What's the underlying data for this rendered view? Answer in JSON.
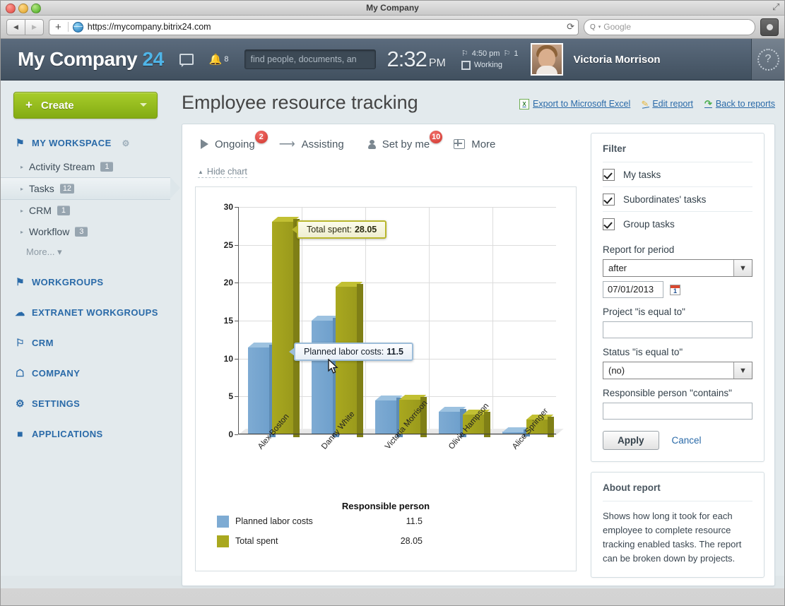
{
  "browser": {
    "window_title": "My Company",
    "url": "https://mycompany.bitrix24.com",
    "search_placeholder": "Google",
    "back_icon": "◀",
    "forward_icon": "▶",
    "plus_icon": "+",
    "reload_icon": "⟳",
    "magnifier_icon": "Q",
    "caret_icon": "▾",
    "resize_icon": "⤢"
  },
  "topbar": {
    "logo_text": "My Company",
    "logo_number": "24",
    "messages_count": "",
    "notifications_count": "8",
    "search_placeholder": "find people, documents, an",
    "clock_time": "2:32",
    "clock_ampm": "PM",
    "status_time": "4:50 pm",
    "status_flag_count": "1",
    "status_label": "Working",
    "user_name": "Victoria Morrison",
    "help_icon": "?"
  },
  "sidebar": {
    "create_label": "Create",
    "sections": [
      {
        "label": "MY WORKSPACE",
        "icon": "bookmark-icon",
        "glyph": "⚑",
        "gear": true
      },
      {
        "label": "WORKGROUPS",
        "icon": "group-icon",
        "glyph": "⚑"
      },
      {
        "label": "EXTRANET WORKGROUPS",
        "icon": "cloud-icon",
        "glyph": "☁"
      },
      {
        "label": "CRM",
        "icon": "flag-icon",
        "glyph": "⚑"
      },
      {
        "label": "COMPANY",
        "icon": "home-icon",
        "glyph": "⌂"
      },
      {
        "label": "SETTINGS",
        "icon": "gear-icon",
        "glyph": "⚙"
      },
      {
        "label": "APPLICATIONS",
        "icon": "cube-icon",
        "glyph": "⬛"
      }
    ],
    "workspace_items": [
      {
        "label": "Activity Stream",
        "badge": "1",
        "active": false
      },
      {
        "label": "Tasks",
        "badge": "12",
        "active": true
      },
      {
        "label": "CRM",
        "badge": "1",
        "active": false
      },
      {
        "label": "Workflow",
        "badge": "3",
        "active": false
      }
    ],
    "more_label": "More..."
  },
  "page": {
    "title": "Employee resource tracking",
    "links": [
      {
        "label": "Export to Microsoft Excel",
        "icon": "excel-icon"
      },
      {
        "label": "Edit report",
        "icon": "pencil-icon"
      },
      {
        "label": "Back to reports",
        "icon": "back-arrow-icon"
      }
    ]
  },
  "tabs": [
    {
      "label": "Ongoing",
      "badge": "2",
      "icon": "play-icon"
    },
    {
      "label": "Assisting",
      "badge": "",
      "icon": "arrow-icon"
    },
    {
      "label": "Set by me",
      "badge": "10",
      "icon": "person-icon"
    },
    {
      "label": "More",
      "badge": "",
      "icon": "grid-icon"
    }
  ],
  "hide_chart_label": "Hide chart",
  "chart_data": {
    "type": "bar",
    "title": "",
    "xlabel": "Responsible person",
    "ylabel": "",
    "categories": [
      "Alex Boston",
      "Danny White",
      "Victoria Morrison",
      "Olivia Hampson",
      "Alice Springer"
    ],
    "series": [
      {
        "name": "Planned labor costs",
        "color": "#7eabd3",
        "values": [
          11.5,
          15.0,
          4.5,
          3.0,
          0.35
        ]
      },
      {
        "name": "Total spent",
        "color": "#a9a81f",
        "values": [
          28.05,
          19.5,
          4.6,
          2.6,
          2.0
        ]
      }
    ],
    "ylim": [
      0,
      30
    ],
    "yticks": [
      0,
      5,
      10,
      15,
      20,
      25,
      30
    ],
    "grid": true,
    "legend_position": "bottom",
    "legend": [
      {
        "name": "Planned labor costs",
        "value": "11.5",
        "color": "#7eabd3"
      },
      {
        "name": "Total spent",
        "value": "28.05",
        "color": "#a9a81f"
      }
    ],
    "tooltips": [
      {
        "label": "Total spent:",
        "value": "28.05",
        "style": "olive"
      },
      {
        "label": "Planned labor costs:",
        "value": "11.5",
        "style": "blue"
      }
    ]
  },
  "filter": {
    "title": "Filter",
    "checkboxes": [
      {
        "label": "My tasks",
        "checked": true
      },
      {
        "label": "Subordinates' tasks",
        "checked": true
      },
      {
        "label": "Group tasks",
        "checked": true
      }
    ],
    "period_label": "Report for period",
    "period_value": "after",
    "date_value": "07/01/2013",
    "project_label": "Project \"is equal to\"",
    "project_value": "",
    "status_label": "Status \"is equal to\"",
    "status_value": "(no)",
    "responsible_label": "Responsible person \"contains\"",
    "responsible_value": "",
    "apply_label": "Apply",
    "cancel_label": "Cancel"
  },
  "about": {
    "title": "About report",
    "text": "Shows how long it took for each employee to complete resource tracking enabled tasks. The report can be broken down by projects."
  }
}
